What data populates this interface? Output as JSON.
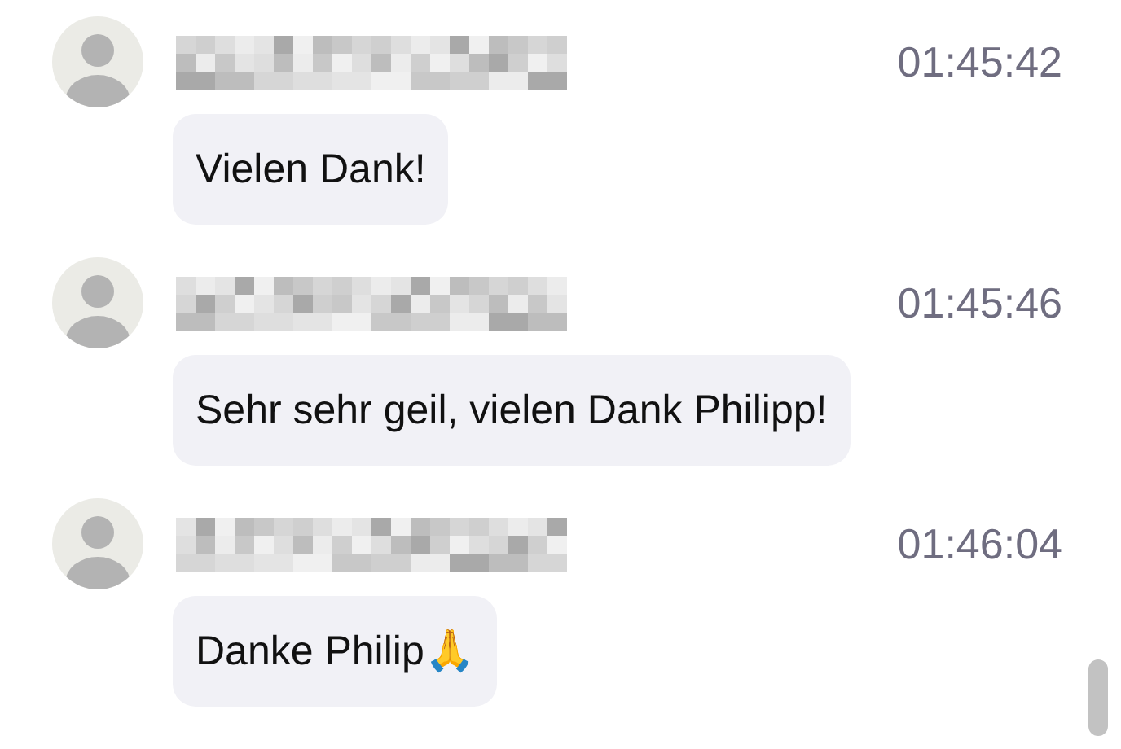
{
  "messages": [
    {
      "time": "01:45:42",
      "text": "Vielen Dank!"
    },
    {
      "time": "01:45:46",
      "text": "Sehr sehr geil, vielen Dank Philipp!"
    },
    {
      "time": "01:46:04",
      "text": "Danke Philip🙏"
    }
  ]
}
